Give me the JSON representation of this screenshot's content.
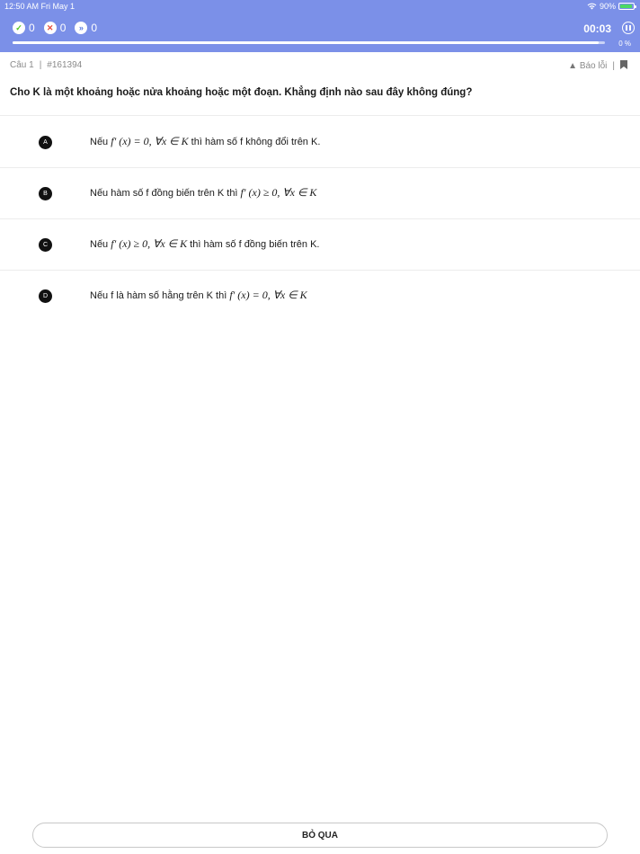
{
  "status_bar": {
    "time": "12:50 AM   Fri May 1",
    "battery": "90%"
  },
  "header": {
    "correct_count": "0",
    "wrong_count": "0",
    "skipped_count": "0",
    "timer": "00:03",
    "progress_label": "0 %",
    "progress_value": 0.99
  },
  "question_meta": {
    "label": "Câu 1",
    "separator": "|",
    "id": "#161394",
    "report_label": "Báo lỗi",
    "right_separator": "|"
  },
  "question": {
    "text": "Cho K là một khoảng hoặc nửa khoảng hoặc một đoạn. Khẳng định nào sau đây không đúng?"
  },
  "options": [
    {
      "letter": "A",
      "pre": "Nếu ",
      "math": "f′ (x) = 0, ∀x ∈ K",
      "post": " thì hàm số f không đổi trên K."
    },
    {
      "letter": "B",
      "pre": "Nếu hàm số f đồng biến trên K thì ",
      "math": "f′ (x) ≥ 0, ∀x ∈ K",
      "post": ""
    },
    {
      "letter": "C",
      "pre": "Nếu ",
      "math": "f′ (x) ≥ 0, ∀x ∈ K",
      "post": " thì hàm số f đồng biến trên K."
    },
    {
      "letter": "D",
      "pre": "Nếu f là hàm số hằng trên K thì ",
      "math": "f′ (x) = 0, ∀x ∈ K",
      "post": ""
    }
  ],
  "footer": {
    "skip_label": "BỎ QUA"
  },
  "colors": {
    "header_bg": "#7b90e8",
    "accent_correct": "#52c41a",
    "accent_wrong": "#e74c3c"
  },
  "icons": [
    "wifi-icon",
    "battery-icon",
    "check-icon",
    "x-icon",
    "skip-icon",
    "pause-icon",
    "warning-icon",
    "bookmark-icon"
  ]
}
